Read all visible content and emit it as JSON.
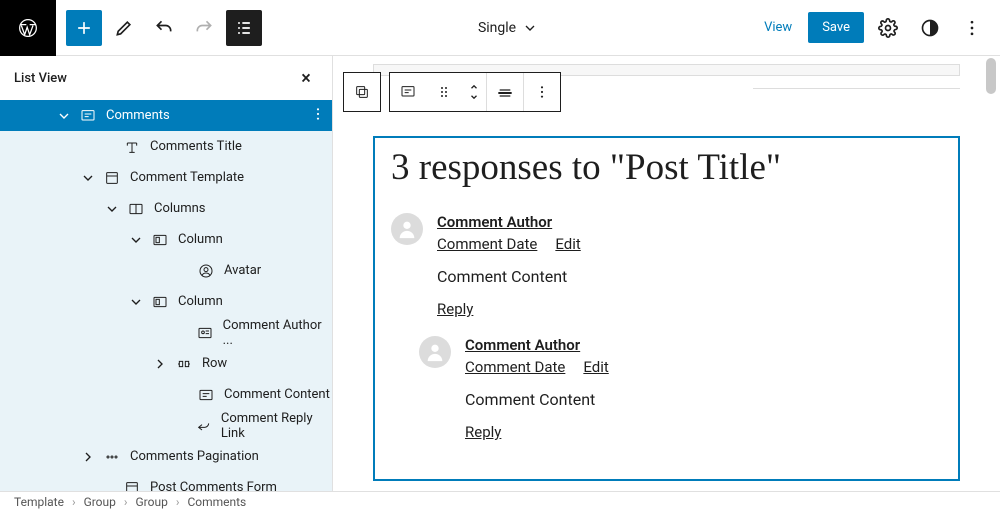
{
  "topbar": {
    "document_label": "Single",
    "view_label": "View",
    "save_label": "Save"
  },
  "sidebar": {
    "title": "List View",
    "items": [
      {
        "label": "Comments",
        "indent": 52,
        "chev": "down",
        "icon": "comments",
        "selected": true
      },
      {
        "label": "Comments Title",
        "indent": 96,
        "chev": "",
        "icon": "title"
      },
      {
        "label": "Comment Template",
        "indent": 76,
        "chev": "down",
        "icon": "template"
      },
      {
        "label": "Columns",
        "indent": 100,
        "chev": "down",
        "icon": "columns"
      },
      {
        "label": "Column",
        "indent": 124,
        "chev": "down",
        "icon": "column"
      },
      {
        "label": "Avatar",
        "indent": 170,
        "chev": "",
        "icon": "avatar"
      },
      {
        "label": "Column",
        "indent": 124,
        "chev": "down",
        "icon": "column"
      },
      {
        "label": "Comment Author ...",
        "indent": 170,
        "chev": "",
        "icon": "author"
      },
      {
        "label": "Row",
        "indent": 148,
        "chev": "right",
        "icon": "row"
      },
      {
        "label": "Comment Content",
        "indent": 170,
        "chev": "",
        "icon": "content"
      },
      {
        "label": "Comment Reply Link",
        "indent": 170,
        "chev": "",
        "icon": "reply"
      },
      {
        "label": "Comments Pagination",
        "indent": 76,
        "chev": "right",
        "icon": "pagination"
      },
      {
        "label": "Post Comments Form",
        "indent": 96,
        "chev": "",
        "icon": "template"
      }
    ]
  },
  "canvas": {
    "title": "3 responses to \"Post Title\"",
    "comments": [
      {
        "author": "Comment Author",
        "date": "Comment Date",
        "edit": "Edit",
        "content": "Comment Content",
        "reply": "Reply",
        "nested": false
      },
      {
        "author": "Comment Author",
        "date": "Comment Date",
        "edit": "Edit",
        "content": "Comment Content",
        "reply": "Reply",
        "nested": true
      }
    ]
  },
  "breadcrumb": [
    "Template",
    "Group",
    "Group",
    "Comments"
  ]
}
